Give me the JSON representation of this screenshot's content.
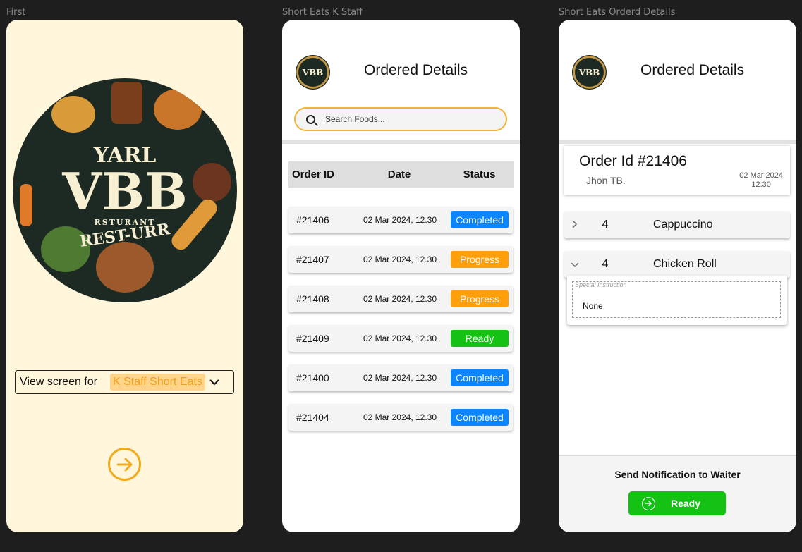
{
  "frames": {
    "first_label": "First",
    "staff_label": "Short Eats K Staff",
    "details_label": "Short Eats Orderd Details"
  },
  "first": {
    "logo": {
      "line1": "YARL",
      "line2": "VBB",
      "line3": "RSTURANT",
      "line4": "REST-URR"
    },
    "view_label": "View screen for",
    "view_value": "K Staff Short Eats",
    "next_icon": "arrow-right-circle-icon"
  },
  "staff": {
    "logo_text": "VBB",
    "title": "Ordered Details",
    "search_placeholder": "Search Foods...",
    "columns": [
      "Order ID",
      "Date",
      "Status"
    ],
    "rows": [
      {
        "id": "#21406",
        "date": "02 Mar 2024, 12.30",
        "status": "Completed"
      },
      {
        "id": "#21407",
        "date": "02 Mar 2024, 12.30",
        "status": "Progress"
      },
      {
        "id": "#21408",
        "date": "02 Mar 2024, 12.30",
        "status": "Progress"
      },
      {
        "id": "#21409",
        "date": "02 Mar 2024, 12.30",
        "status": "Ready"
      },
      {
        "id": "#21400",
        "date": "02 Mar 2024, 12.30",
        "status": "Completed"
      },
      {
        "id": "#21404",
        "date": "02 Mar 2024, 12.30",
        "status": "Completed"
      }
    ],
    "status_colors": {
      "Completed": "#0a84ff",
      "Progress": "#ff9f0a",
      "Ready": "#14c214"
    }
  },
  "details": {
    "logo_text": "VBB",
    "title": "Ordered Details",
    "order_id": "Order Id #21406",
    "customer": "Jhon TB.",
    "date": "02 Mar 2024",
    "time": "12.30",
    "items": [
      {
        "qty": "4",
        "name": "Cappuccino",
        "expanded": false
      },
      {
        "qty": "4",
        "name": "Chicken Roll",
        "expanded": true
      }
    ],
    "instruction_label": "Special Instruction",
    "instruction_value": "None",
    "notify_title": "Send Notification to Waiter",
    "ready_label": "Ready"
  },
  "colors": {
    "background": "#1e1e1e",
    "cream": "#fff6dc",
    "accent": "#f2aa1b",
    "green": "#14c214",
    "blue": "#0a84ff"
  }
}
